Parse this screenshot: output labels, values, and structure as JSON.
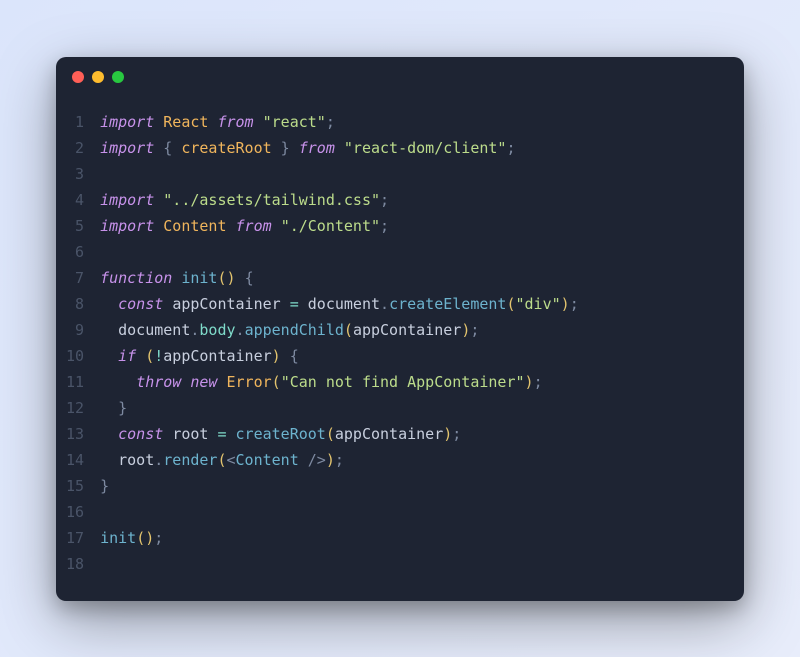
{
  "window": {
    "traffic_lights": [
      "close",
      "minimize",
      "zoom"
    ]
  },
  "editor": {
    "line_numbers": [
      "1",
      "2",
      "3",
      "4",
      "5",
      "6",
      "7",
      "8",
      "9",
      "10",
      "11",
      "12",
      "13",
      "14",
      "15",
      "16",
      "17",
      "18"
    ],
    "lines": [
      [
        {
          "c": "kw",
          "t": "import"
        },
        {
          "c": "sp",
          "t": " "
        },
        {
          "c": "def",
          "t": "React"
        },
        {
          "c": "sp",
          "t": " "
        },
        {
          "c": "from",
          "t": "from"
        },
        {
          "c": "sp",
          "t": " "
        },
        {
          "c": "str",
          "t": "\"react\""
        },
        {
          "c": "punc",
          "t": ";"
        }
      ],
      [
        {
          "c": "kw",
          "t": "import"
        },
        {
          "c": "sp",
          "t": " "
        },
        {
          "c": "punc",
          "t": "{ "
        },
        {
          "c": "def",
          "t": "createRoot"
        },
        {
          "c": "punc",
          "t": " }"
        },
        {
          "c": "sp",
          "t": " "
        },
        {
          "c": "from",
          "t": "from"
        },
        {
          "c": "sp",
          "t": " "
        },
        {
          "c": "str",
          "t": "\"react-dom/client\""
        },
        {
          "c": "punc",
          "t": ";"
        }
      ],
      [],
      [
        {
          "c": "kw",
          "t": "import"
        },
        {
          "c": "sp",
          "t": " "
        },
        {
          "c": "str",
          "t": "\"../assets/tailwind.css\""
        },
        {
          "c": "punc",
          "t": ";"
        }
      ],
      [
        {
          "c": "kw",
          "t": "import"
        },
        {
          "c": "sp",
          "t": " "
        },
        {
          "c": "def",
          "t": "Content"
        },
        {
          "c": "sp",
          "t": " "
        },
        {
          "c": "from",
          "t": "from"
        },
        {
          "c": "sp",
          "t": " "
        },
        {
          "c": "str",
          "t": "\"./Content\""
        },
        {
          "c": "punc",
          "t": ";"
        }
      ],
      [],
      [
        {
          "c": "kw",
          "t": "function"
        },
        {
          "c": "sp",
          "t": " "
        },
        {
          "c": "call",
          "t": "init"
        },
        {
          "c": "paren",
          "t": "()"
        },
        {
          "c": "sp",
          "t": " "
        },
        {
          "c": "punc",
          "t": "{"
        }
      ],
      [
        {
          "c": "sp",
          "t": "  "
        },
        {
          "c": "kw",
          "t": "const"
        },
        {
          "c": "sp",
          "t": " "
        },
        {
          "c": "ident",
          "t": "appContainer"
        },
        {
          "c": "sp",
          "t": " "
        },
        {
          "c": "op",
          "t": "="
        },
        {
          "c": "sp",
          "t": " "
        },
        {
          "c": "ident",
          "t": "document"
        },
        {
          "c": "punc",
          "t": "."
        },
        {
          "c": "call",
          "t": "createElement"
        },
        {
          "c": "paren",
          "t": "("
        },
        {
          "c": "str",
          "t": "\"div\""
        },
        {
          "c": "paren",
          "t": ")"
        },
        {
          "c": "punc",
          "t": ";"
        }
      ],
      [
        {
          "c": "sp",
          "t": "  "
        },
        {
          "c": "ident",
          "t": "document"
        },
        {
          "c": "punc",
          "t": "."
        },
        {
          "c": "prop",
          "t": "body"
        },
        {
          "c": "punc",
          "t": "."
        },
        {
          "c": "call",
          "t": "appendChild"
        },
        {
          "c": "paren",
          "t": "("
        },
        {
          "c": "ident",
          "t": "appContainer"
        },
        {
          "c": "paren",
          "t": ")"
        },
        {
          "c": "punc",
          "t": ";"
        }
      ],
      [
        {
          "c": "sp",
          "t": "  "
        },
        {
          "c": "kw",
          "t": "if"
        },
        {
          "c": "sp",
          "t": " "
        },
        {
          "c": "paren",
          "t": "("
        },
        {
          "c": "op",
          "t": "!"
        },
        {
          "c": "ident",
          "t": "appContainer"
        },
        {
          "c": "paren",
          "t": ")"
        },
        {
          "c": "sp",
          "t": " "
        },
        {
          "c": "punc",
          "t": "{"
        }
      ],
      [
        {
          "c": "sp",
          "t": "    "
        },
        {
          "c": "kw",
          "t": "throw"
        },
        {
          "c": "sp",
          "t": " "
        },
        {
          "c": "kw",
          "t": "new"
        },
        {
          "c": "sp",
          "t": " "
        },
        {
          "c": "def",
          "t": "Error"
        },
        {
          "c": "paren",
          "t": "("
        },
        {
          "c": "str",
          "t": "\"Can not find AppContainer\""
        },
        {
          "c": "paren",
          "t": ")"
        },
        {
          "c": "punc",
          "t": ";"
        }
      ],
      [
        {
          "c": "sp",
          "t": "  "
        },
        {
          "c": "punc",
          "t": "}"
        }
      ],
      [
        {
          "c": "sp",
          "t": "  "
        },
        {
          "c": "kw",
          "t": "const"
        },
        {
          "c": "sp",
          "t": " "
        },
        {
          "c": "ident",
          "t": "root"
        },
        {
          "c": "sp",
          "t": " "
        },
        {
          "c": "op",
          "t": "="
        },
        {
          "c": "sp",
          "t": " "
        },
        {
          "c": "call",
          "t": "createRoot"
        },
        {
          "c": "paren",
          "t": "("
        },
        {
          "c": "ident",
          "t": "appContainer"
        },
        {
          "c": "paren",
          "t": ")"
        },
        {
          "c": "punc",
          "t": ";"
        }
      ],
      [
        {
          "c": "sp",
          "t": "  "
        },
        {
          "c": "ident",
          "t": "root"
        },
        {
          "c": "punc",
          "t": "."
        },
        {
          "c": "call",
          "t": "render"
        },
        {
          "c": "paren",
          "t": "("
        },
        {
          "c": "tagang",
          "t": "<"
        },
        {
          "c": "tag",
          "t": "Content"
        },
        {
          "c": "sp",
          "t": " "
        },
        {
          "c": "tagang",
          "t": "/>"
        },
        {
          "c": "paren",
          "t": ")"
        },
        {
          "c": "punc",
          "t": ";"
        }
      ],
      [
        {
          "c": "punc",
          "t": "}"
        }
      ],
      [],
      [
        {
          "c": "call",
          "t": "init"
        },
        {
          "c": "paren",
          "t": "()"
        },
        {
          "c": "punc",
          "t": ";"
        }
      ],
      []
    ]
  }
}
